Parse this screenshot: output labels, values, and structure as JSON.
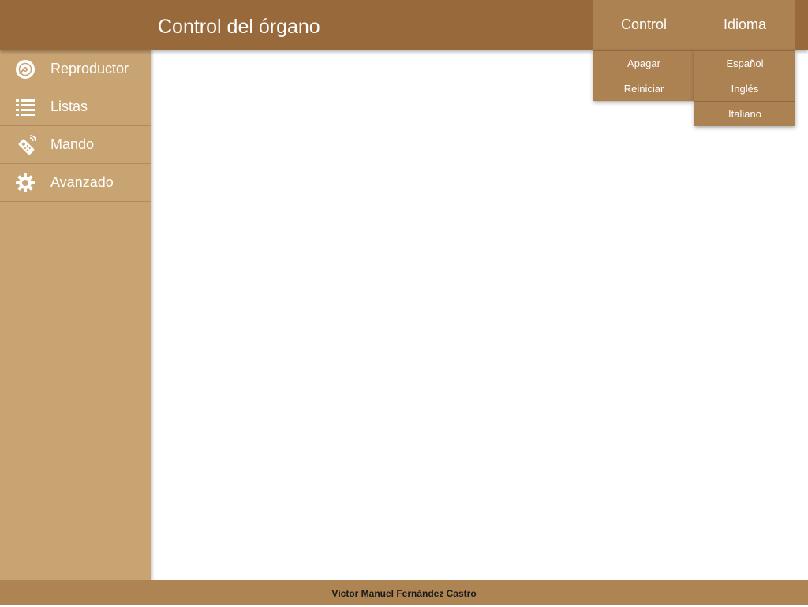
{
  "header": {
    "title": "Control del órgano",
    "menus": [
      {
        "label": "Control",
        "items": [
          "Apagar",
          "Reiniciar"
        ]
      },
      {
        "label": "Idioma",
        "items": [
          "Español",
          "Inglés",
          "Italiano"
        ]
      }
    ]
  },
  "sidebar": {
    "items": [
      {
        "label": "Reproductor",
        "icon": "disc-icon"
      },
      {
        "label": "Listas",
        "icon": "list-icon"
      },
      {
        "label": "Mando",
        "icon": "remote-control-icon"
      },
      {
        "label": "Avanzado",
        "icon": "gear-icon"
      }
    ]
  },
  "footer": {
    "text": "Víctor Manuel Fernández Castro"
  },
  "colors": {
    "header": "#98693b",
    "menu": "#ad8253",
    "sidebar": "#c9a473",
    "footer": "#ae8453"
  }
}
